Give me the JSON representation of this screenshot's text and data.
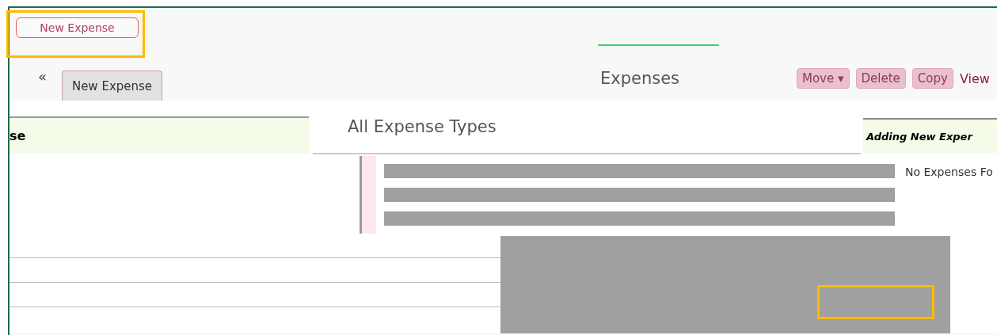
{
  "toolbar": {
    "new_button": "New Expense"
  },
  "collapse": "«",
  "tabs": [
    {
      "label": "New Expense",
      "selected": true
    }
  ],
  "expenses": {
    "title": "Expenses",
    "buttons": [
      {
        "label": "Move ▾",
        "disabled": true
      },
      {
        "label": "Delete",
        "disabled": true
      },
      {
        "label": "Copy",
        "disabled": true
      }
    ],
    "view_link": "View"
  },
  "left_banner": "se",
  "type_field": {
    "value": "All Expense Types"
  },
  "right_banner": "Adding New Exper",
  "empty_message": "No Expenses Fo"
}
